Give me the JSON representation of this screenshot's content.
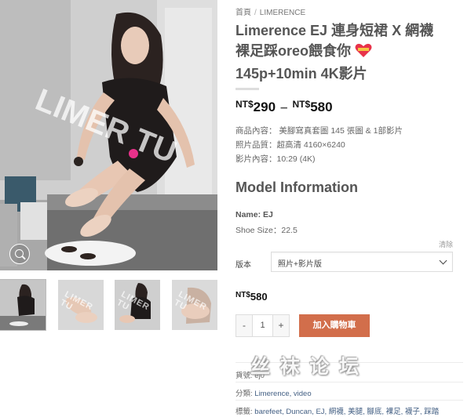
{
  "breadcrumb": {
    "home": "首頁",
    "separator": "/",
    "category": "LIMERENCE"
  },
  "product": {
    "title_line1": "Limerence EJ 連身短裙 X 網襪",
    "title_line2": "裸足踩oreo餵食你",
    "title_line3": "145p+10min 4K影片",
    "heart_icon": "heart-emoji-icon",
    "price_currency": "NT$",
    "price_min": "290",
    "price_dash": "–",
    "price_max": "580",
    "desc_lines": [
      "商品內容：  美腳寫真套圖 145 張圖 & 1部影片",
      "照片品質：超高清 4160×6240",
      "影片內容：10:29 (4K)"
    ]
  },
  "model_info": {
    "heading": "Model Information",
    "name_label": "Name: ",
    "name_value": "EJ",
    "shoe_label": "Shoe Size：",
    "shoe_value": "22.5"
  },
  "variation": {
    "clear_label": "清除",
    "label": "版本",
    "selected": "照片+影片版"
  },
  "selected_price": {
    "currency": "NT$",
    "value": "580"
  },
  "cart": {
    "minus": "-",
    "qty": "1",
    "plus": "+",
    "add_label": "加入購物車"
  },
  "meta": {
    "sku_label": "貨號:",
    "sku_value": "ej0",
    "cat_label": "分類:",
    "cat_value": "Limerence, video",
    "tag_label": "標籤:",
    "tag_value": "barefeet, Duncan, EJ, 網襪, 美腿, 腳底, 裸足, 襪子, 踩踏"
  },
  "gallery": {
    "main_watermark": "LIMER TU",
    "thumb_watermark": "LIMER TU"
  },
  "site_watermark": "丝 袜 论 坛",
  "colors": {
    "accent": "#d26e4b",
    "link": "#446084",
    "watermark_dot": "#e8318a"
  }
}
